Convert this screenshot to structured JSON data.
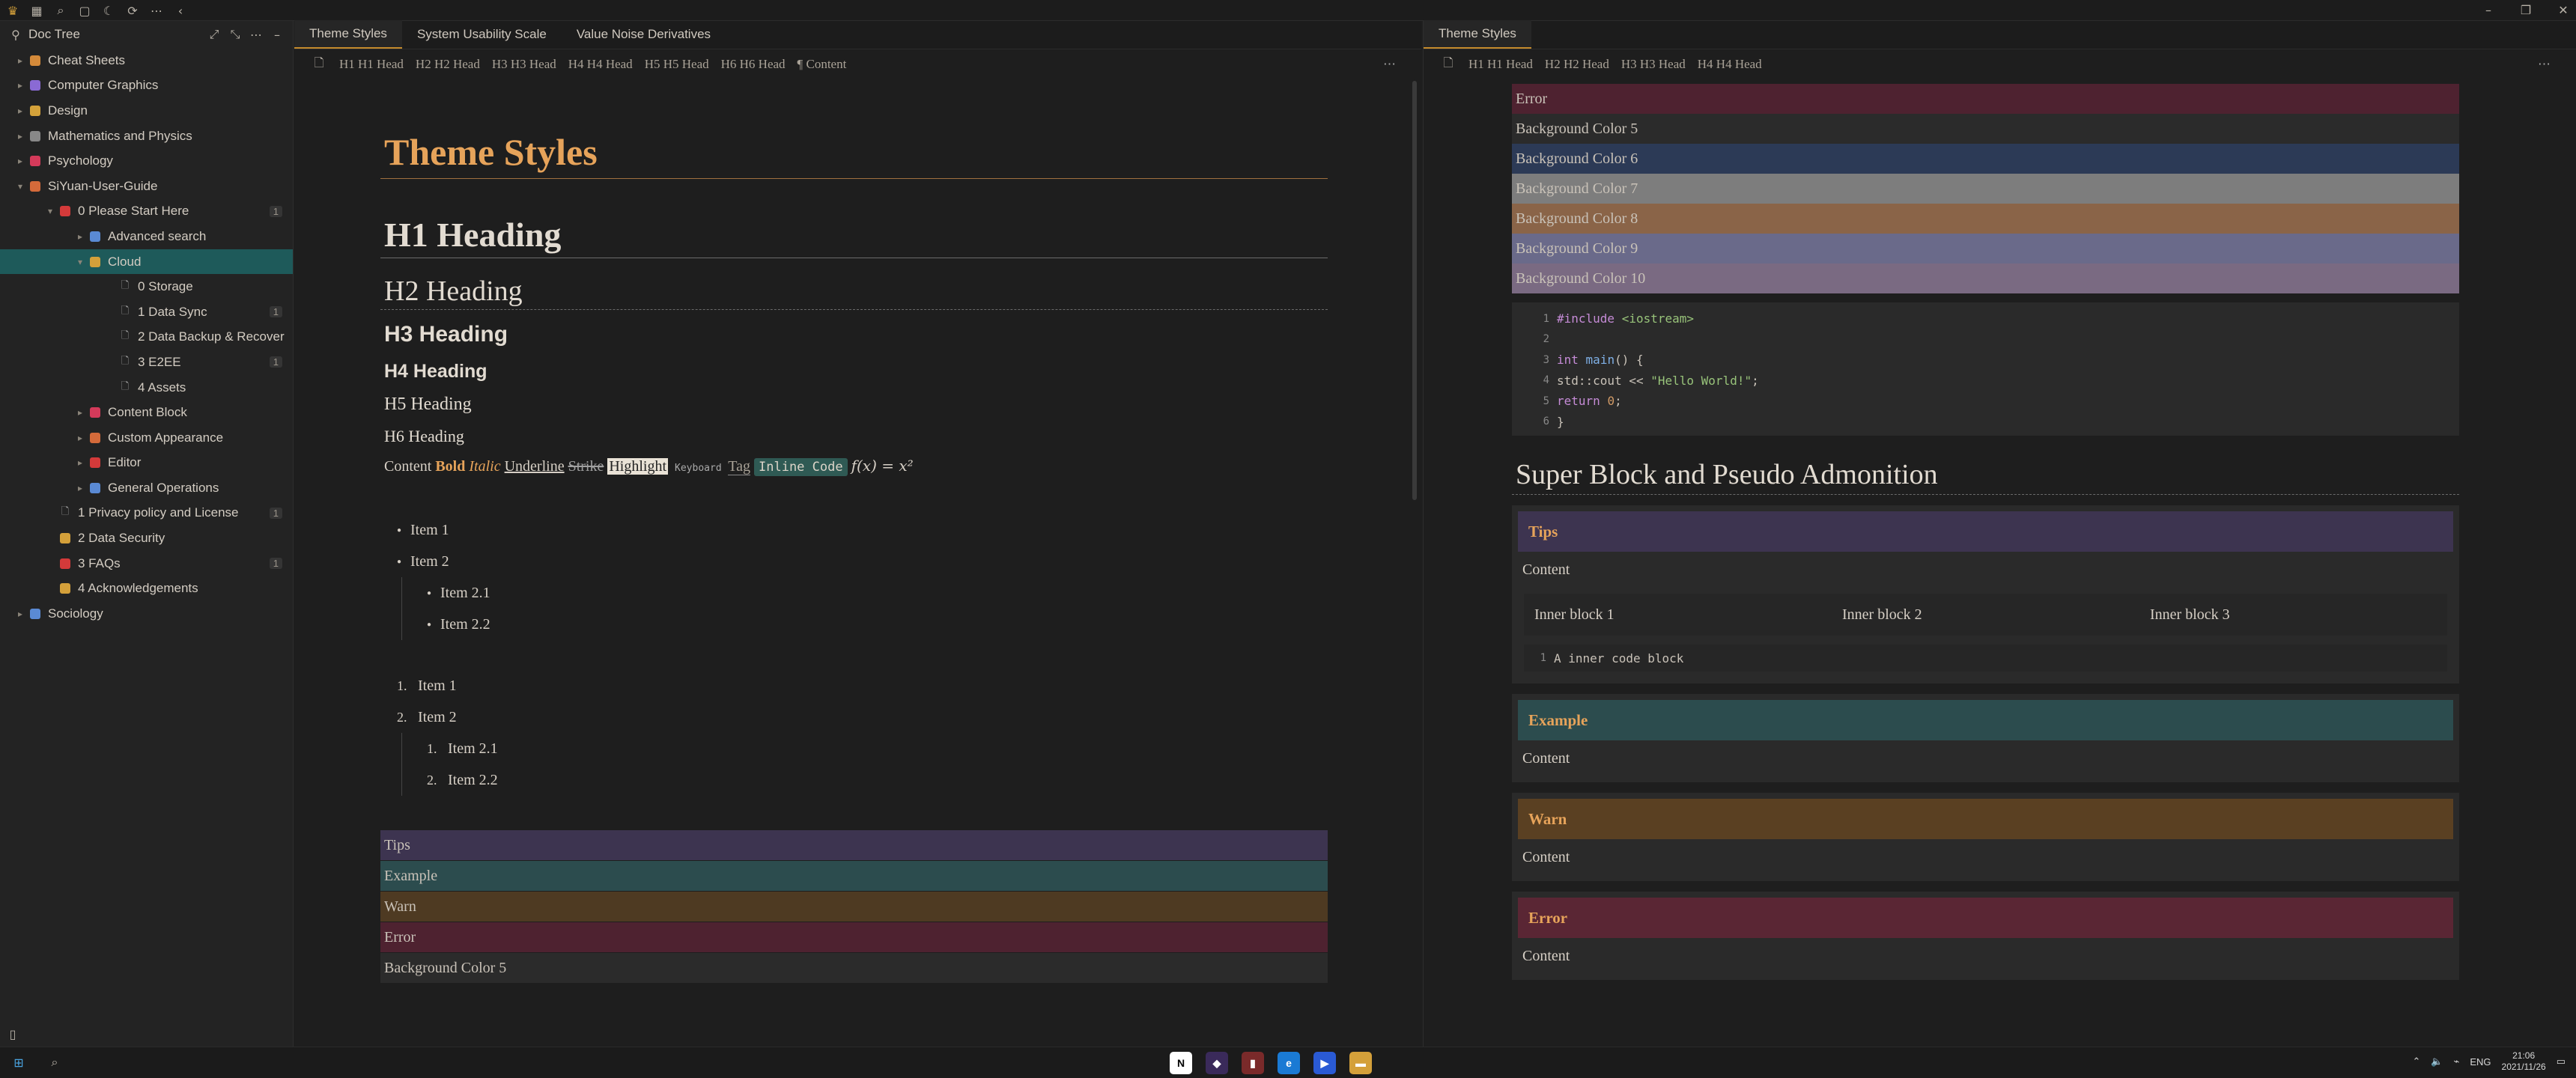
{
  "sidebar": {
    "title": "Doc Tree",
    "items": [
      {
        "label": "Cheat Sheets",
        "emoji_color": "#d48a3a",
        "count": ""
      },
      {
        "label": "Computer Graphics",
        "emoji_color": "#8a6ad4",
        "count": ""
      },
      {
        "label": "Design",
        "emoji_color": "#d4a23a",
        "count": ""
      },
      {
        "label": "Mathematics and Physics",
        "emoji_color": "#888",
        "count": ""
      },
      {
        "label": "Psychology",
        "emoji_color": "#d43a5a",
        "count": ""
      },
      {
        "label": "SiYuan-User-Guide",
        "emoji_color": "#d46a3a",
        "count": ""
      },
      {
        "label": "0 Please Start Here",
        "emoji_color": "#d43a3a",
        "count": "1"
      },
      {
        "label": "Advanced search",
        "emoji_color": "#5a8ad4",
        "count": ""
      },
      {
        "label": "Cloud",
        "emoji_color": "#d4a03a",
        "count": ""
      },
      {
        "label": "0 Storage",
        "emoji_color": "",
        "count": ""
      },
      {
        "label": "1 Data Sync",
        "emoji_color": "",
        "count": "1"
      },
      {
        "label": "2 Data Backup & Recover",
        "emoji_color": "",
        "count": ""
      },
      {
        "label": "3 E2EE",
        "emoji_color": "",
        "count": "1"
      },
      {
        "label": "4 Assets",
        "emoji_color": "",
        "count": ""
      },
      {
        "label": "Content Block",
        "emoji_color": "#d43a5a",
        "count": ""
      },
      {
        "label": "Custom Appearance",
        "emoji_color": "#d46a3a",
        "count": ""
      },
      {
        "label": "Editor",
        "emoji_color": "#d43a3a",
        "count": ""
      },
      {
        "label": "General Operations",
        "emoji_color": "#5a8ad4",
        "count": ""
      },
      {
        "label": "1 Privacy policy and License",
        "emoji_color": "",
        "count": "1"
      },
      {
        "label": "2 Data Security",
        "emoji_color": "#d4a03a",
        "count": ""
      },
      {
        "label": "3 FAQs",
        "emoji_color": "#d43a3a",
        "count": "1"
      },
      {
        "label": "4 Acknowledgements",
        "emoji_color": "#d4a03a",
        "count": ""
      },
      {
        "label": "Sociology",
        "emoji_color": "#5a8ad4",
        "count": ""
      }
    ]
  },
  "left_pane": {
    "tabs": [
      "Theme Styles",
      "System Usability Scale",
      "Value Noise Derivatives"
    ],
    "crumbs": [
      "H1 H1 Head",
      "H2 H2 Head",
      "H3 H3 Head",
      "H4 H4 Head",
      "H5 H5 Head",
      "H6 H6 Head",
      "¶ Content"
    ],
    "title": "Theme Styles",
    "h1": "H1 Heading",
    "h2": "H2 Heading",
    "h3": "H3 Heading",
    "h4": "H4 Heading",
    "h5": "H5 Heading",
    "h6": "H6 Heading",
    "inline": {
      "content": "Content",
      "bold": "Bold",
      "italic": "Italic",
      "underline": "Underline",
      "strike": "Strike",
      "highlight": "Highlight",
      "keyboard": "Keyboard",
      "tag": "Tag",
      "code": "Inline Code",
      "math": "f(x) = x²"
    },
    "ul": [
      "Item 1",
      "Item 2",
      "Item 2.1",
      "Item 2.2"
    ],
    "ol": [
      "Item 1",
      "Item 2",
      "Item 2.1",
      "Item 2.2"
    ],
    "ol_markers": [
      "1.",
      "2.",
      "1.",
      "2."
    ],
    "callouts": [
      {
        "label": "Tips",
        "color": "#3d3450"
      },
      {
        "label": "Example",
        "color": "#2c4c4e"
      },
      {
        "label": "Warn",
        "color": "#4e3a22"
      },
      {
        "label": "Error",
        "color": "#4e2230"
      },
      {
        "label": "Background Color 5",
        "color": "#2b2b2b"
      }
    ]
  },
  "right_pane": {
    "tabs": [
      "Theme Styles"
    ],
    "crumbs": [
      "H1 H1 Head",
      "H2 H2 Head",
      "H3 H3 Head",
      "H4 H4 Head"
    ],
    "bg_rows": [
      {
        "label": "Error",
        "color": "#4e2230"
      },
      {
        "label": "Background Color 5",
        "color": "#2b2b2b"
      },
      {
        "label": "Background Color 6",
        "color": "#2c3a56"
      },
      {
        "label": "Background Color 7",
        "color": "#7d7d7d"
      },
      {
        "label": "Background Color 8",
        "color": "#8a6448"
      },
      {
        "label": "Background Color 9",
        "color": "#6a6a8a"
      },
      {
        "label": "Background Color 10",
        "color": "#7a6a82"
      }
    ],
    "code": {
      "lines": [
        "#include <iostream>",
        "",
        "int main() {",
        "    std::cout << \"Hello World!\";",
        "    return 0;",
        "}"
      ]
    },
    "super_heading": "Super Block and Pseudo Admonition",
    "admonitions": [
      {
        "title": "Tips",
        "content": "Content",
        "color": "#3d3450"
      },
      {
        "title": "Example",
        "content": "Content",
        "color": "#2c4c4e"
      },
      {
        "title": "Warn",
        "content": "Content",
        "color": "#5a4022"
      },
      {
        "title": "Error",
        "content": "Content",
        "color": "#5a2634"
      }
    ],
    "inner_blocks": [
      "Inner block 1",
      "Inner block 2",
      "Inner block 3"
    ],
    "inner_code": "A inner code block"
  },
  "taskbar": {
    "lang": "ENG",
    "time": "21:06",
    "date": "2021/11/26"
  }
}
